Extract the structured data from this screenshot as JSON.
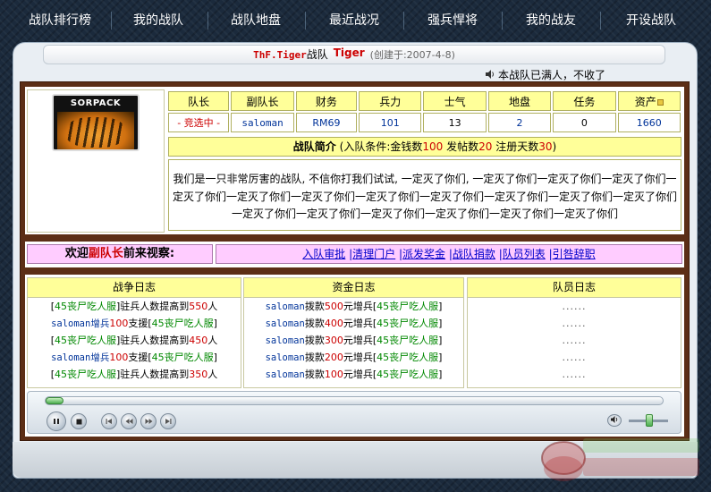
{
  "nav": [
    "战队排行榜",
    "我的战队",
    "战队地盘",
    "最近战况",
    "强兵悍将",
    "我的战友",
    "开设战队"
  ],
  "title": {
    "team_name": "ThF.Tiger",
    "team_word": "战队",
    "tiger_label": "Tiger",
    "created": "(创建于:2007-4-8)"
  },
  "notice": "本战队已满人，不收了",
  "logo": {
    "text": "SORPACK"
  },
  "stats": {
    "headers": [
      "队长",
      "副队长",
      "财务",
      "兵力",
      "士气",
      "地盘",
      "任务",
      "资产"
    ],
    "values": [
      "- 竞选中 -",
      "saloman",
      "RM69",
      "101",
      "13",
      "2",
      "0",
      "1660"
    ]
  },
  "intro": {
    "title": "战队简介",
    "cond_prefix": "(入队条件:金钱数",
    "money": "100",
    "posts_label": " 发帖数",
    "posts": "20",
    "days_label": " 注册天数",
    "days": "30",
    "cond_suffix": ")",
    "body": "我们是一只非常厉害的战队, 不信你打我们试试, 一定灭了你们, 一定灭了你们一定灭了你们一定灭了你们一定灭了你们一定灭了你们一定灭了你们一定灭了你们一定灭了你们一定灭了你们一定灭了你们一定灭了你们一定灭了你们一定灭了你们一定灭了你们一定灭了你们一定灭了你们一定灭了你们"
  },
  "welcome": {
    "prefix": "欢迎",
    "role": "副队长",
    "suffix": "前来视察:"
  },
  "actions": [
    "入队审批",
    "清理门户",
    "派发奖金",
    "战队捐款",
    "队员列表",
    "引咎辞职"
  ],
  "logs": {
    "war": {
      "title": "战争日志",
      "lines": [
        {
          "a": "[",
          "b": "45丧尸吃人服",
          "c": "]驻兵人数提高到",
          "d": "550",
          "e": "人"
        },
        {
          "a": "saloman增兵",
          "b": "100",
          "c": "支援[",
          "d": "45丧尸吃人服",
          "e": "]"
        },
        {
          "a": "[",
          "b": "45丧尸吃人服",
          "c": "]驻兵人数提高到",
          "d": "450",
          "e": "人"
        },
        {
          "a": "saloman增兵",
          "b": "100",
          "c": "支援[",
          "d": "45丧尸吃人服",
          "e": "]"
        },
        {
          "a": "[",
          "b": "45丧尸吃人服",
          "c": "]驻兵人数提高到",
          "d": "350",
          "e": "人"
        }
      ]
    },
    "fund": {
      "title": "资金日志",
      "lines": [
        {
          "user": "saloman",
          "a": "拨款",
          "amt": "500",
          "b": "元增兵[",
          "srv": "45丧尸吃人服",
          "c": "]"
        },
        {
          "user": "saloman",
          "a": "拨款",
          "amt": "400",
          "b": "元增兵[",
          "srv": "45丧尸吃人服",
          "c": "]"
        },
        {
          "user": "saloman",
          "a": "拨款",
          "amt": "300",
          "b": "元增兵[",
          "srv": "45丧尸吃人服",
          "c": "]"
        },
        {
          "user": "saloman",
          "a": "拨款",
          "amt": "200",
          "b": "元增兵[",
          "srv": "45丧尸吃人服",
          "c": "]"
        },
        {
          "user": "saloman",
          "a": "拨款",
          "amt": "100",
          "b": "元增兵[",
          "srv": "45丧尸吃人服",
          "c": "]"
        }
      ]
    },
    "member": {
      "title": "队员日志",
      "lines": [
        "......",
        "......",
        "......",
        "......",
        "......"
      ]
    }
  },
  "player": {
    "play_icon": "pause-icon",
    "stop_icon": "stop-icon",
    "prev_icon": "prev-icon",
    "rewind_icon": "rewind-icon",
    "forward_icon": "forward-icon",
    "next_icon": "next-icon",
    "volume_icon": "volume-icon",
    "seek_position": 0,
    "volume_level": 0.5
  },
  "colors": {
    "accent_red": "#cc0000",
    "server_green": "#008800",
    "link_blue": "#0000cc",
    "panel_brown": "#5c2e16",
    "header_yellow": "#ffff99",
    "pink": "#ffccff"
  }
}
